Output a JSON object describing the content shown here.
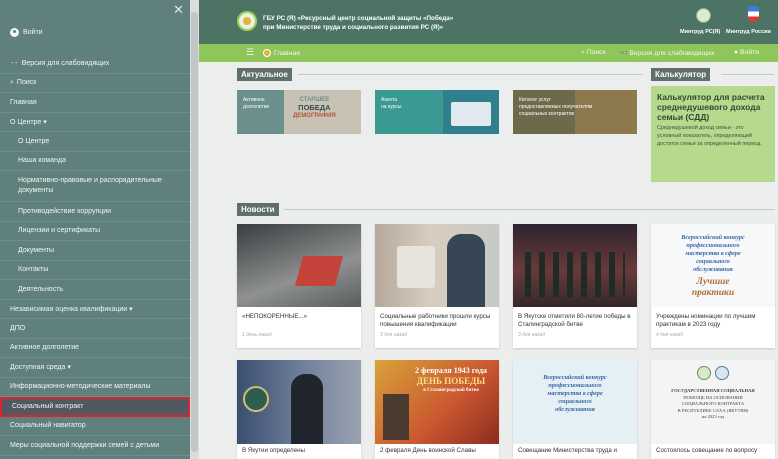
{
  "sidebar": {
    "login_label": "Войти",
    "items": [
      {
        "label": "Версия для слабовидящих",
        "prefix": "👓",
        "type": "top"
      },
      {
        "label": "Поиск",
        "prefix": "🔍",
        "type": "top"
      },
      {
        "label": "Главная",
        "type": "top"
      },
      {
        "label": "О Центре ▾",
        "type": "top"
      },
      {
        "label": "О Центре",
        "type": "sub"
      },
      {
        "label": "Наша команда",
        "type": "sub"
      },
      {
        "label": "Нормативно-правовые и распорядительные документы",
        "type": "sub-wrap"
      },
      {
        "label": "Противодействие коррупции",
        "type": "sub"
      },
      {
        "label": "Лицензии и сертификаты",
        "type": "sub"
      },
      {
        "label": "Документы",
        "type": "sub"
      },
      {
        "label": "Контакты",
        "type": "sub"
      },
      {
        "label": "Деятельность",
        "type": "sub"
      },
      {
        "label": "Независимая оценка квалификации ▾",
        "type": "top"
      },
      {
        "label": "ДПО",
        "type": "top"
      },
      {
        "label": "Активное долголетие",
        "type": "top"
      },
      {
        "label": "Доступная среда ▾",
        "type": "top"
      },
      {
        "label": "Информационно-методические материалы",
        "type": "top"
      },
      {
        "label": "Социальный контракт",
        "type": "top-active"
      },
      {
        "label": "Социальный навигатор",
        "type": "top"
      },
      {
        "label": "Меры социальной поддержки семей с детьми",
        "type": "top"
      }
    ]
  },
  "header": {
    "org_line1": "ГБУ РС (Я) «Ресурсный центр социальной защиты «Победа»",
    "org_line2": "при Министерстве труда и социального развития РС (Я)»",
    "ministry_ya": "Минтруд РС(Я)",
    "ministry_ru": "Минтруд России"
  },
  "nav": {
    "home": "Главная",
    "search": "Поиск",
    "low_vision": "Версия для слабовидящих",
    "login": "Войти"
  },
  "sections": {
    "actual": "Актуальное",
    "calculator": "Калькулятор",
    "news": "Новости"
  },
  "banners": [
    {
      "text_line1": "Активное",
      "text_line2": "долголетие",
      "overlay_line1": "СТАРШЕЕ",
      "overlay_line2": "ПОБЕДА",
      "overlay_line3": "ДЕМОГРАФИЯ"
    },
    {
      "text_line1": "Анкета",
      "text_line2": "на курсы"
    },
    {
      "text_line1": "Каталог услуг",
      "text_line2": "предоставляемых получателям",
      "text_line3": "социальных контрактов"
    }
  ],
  "calculator": {
    "title": "Калькулятор для расчета среднедушевого дохода семьи (СДД)",
    "description": "Среднедушевой доход семьи - это условный показатель, определяющий достаток семьи за определенный период."
  },
  "news": [
    {
      "caption": "«НЕПОКОРЕННЫЕ...»",
      "date": "1 день назад"
    },
    {
      "caption": "Социальные работники прошли курсы повышения квалификации",
      "date": "3 дня назад"
    },
    {
      "caption": "В Якутске отметили 80-летие победы в Сталинградской битве",
      "date": "3 дня назад"
    },
    {
      "caption": "Учреждены номинации по лучшим практикам в 2023 году",
      "date": "4 дня назад",
      "poster_line1": "Всероссийский конкурс",
      "poster_line2": "профессионального",
      "poster_line3": "мастерства в сфере",
      "poster_line4": "социального",
      "poster_line5": "обслуживания",
      "poster_big1": "Лучшие",
      "poster_big2": "практики"
    },
    {
      "caption": "В Якутии определены"
    },
    {
      "caption": "2 февраля День воинской Славы",
      "poster_line1": "2 февраля 1943 года",
      "poster_line2": "ДЕНЬ ПОБЕДЫ",
      "poster_line3": "в Сталинградской битве"
    },
    {
      "caption": "Совещание Министерства труда и",
      "poster_line1": "Всероссийский конкурс",
      "poster_line2": "профессионального",
      "poster_line3": "мастерства в сфере",
      "poster_line4": "социального",
      "poster_line5": "обслуживания"
    },
    {
      "caption": "Состоялось совещание по вопросу",
      "poster_line1": "ГОСУДАРСТВЕННАЯ СОЦИАЛЬНАЯ",
      "poster_line2": "ПОМОЩЬ НА ОСНОВАНИИ",
      "poster_line3": "СОЦИАЛЬНОГО КОНТРАКТА",
      "poster_line4": "В РЕСПУБЛИКЕ САХА (ЯКУТИЯ)",
      "poster_line5": "на 2023 год"
    }
  ],
  "colors": {
    "sidebar_bg": "#5f807c",
    "header_bg": "#4c7363",
    "nav_bg": "#8ec65a",
    "calc_bg": "#b6d98d",
    "active_outline": "#d9262c"
  }
}
